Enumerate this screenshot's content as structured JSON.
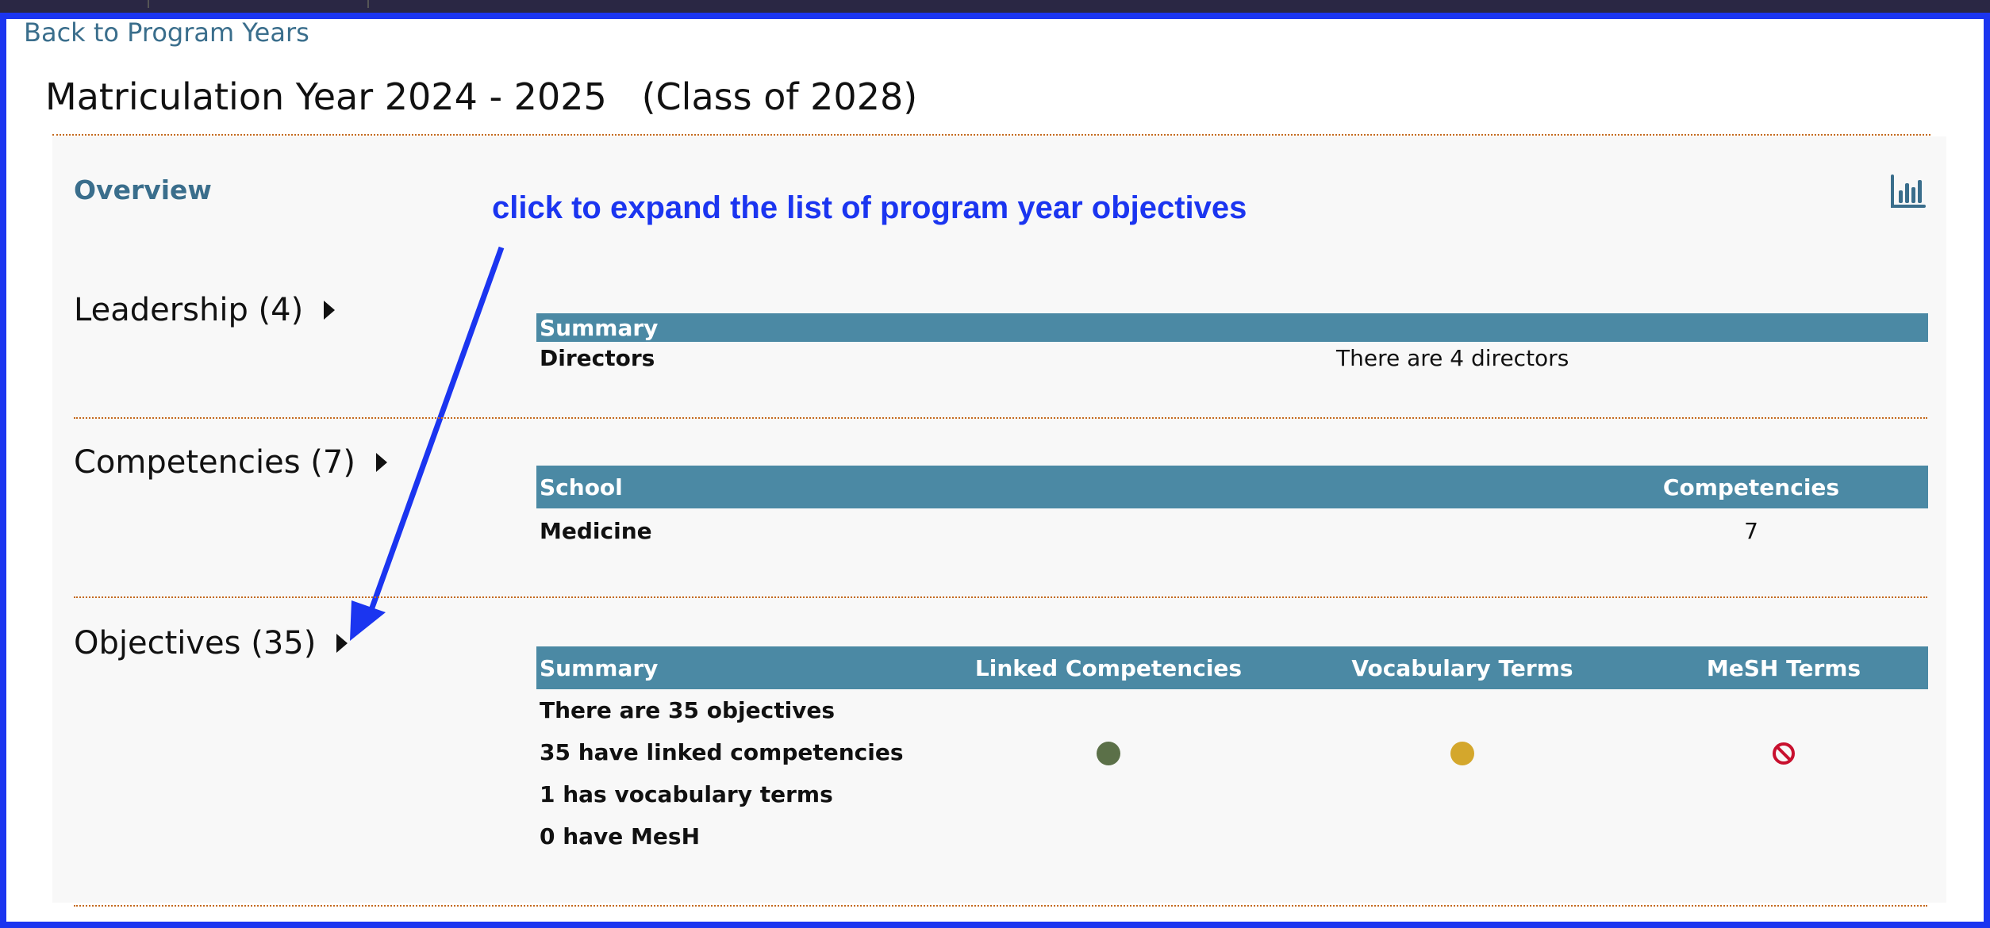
{
  "back_link": "Back to Program Years",
  "title": "Matriculation Year 2024 - 2025   (Class of 2028)",
  "overview_label": "Overview",
  "annotation": "click to expand the list of program year objectives",
  "leadership": {
    "title": "Leadership (4)",
    "header": "Summary",
    "row_label": "Directors",
    "row_value": "There are 4 directors"
  },
  "competencies": {
    "title": "Competencies (7)",
    "headers": [
      "School",
      "Competencies"
    ],
    "row_school": "Medicine",
    "row_count": "7"
  },
  "objectives": {
    "title": "Objectives (35)",
    "headers": [
      "Summary",
      "Linked Competencies",
      "Vocabulary Terms",
      "MeSH Terms"
    ],
    "rows": [
      "There are 35 objectives",
      "35 have linked competencies",
      "1 has vocabulary terms",
      "0 have MesH"
    ],
    "status": {
      "linked_competencies": {
        "icon": "status-dot-icon",
        "color": "#5b7048"
      },
      "vocabulary_terms": {
        "icon": "status-dot-icon",
        "color": "#d4a72c"
      },
      "mesh_terms": {
        "icon": "prohibited-icon",
        "color": "#c8102e"
      }
    }
  },
  "colors": {
    "frame_border": "#1b35f0",
    "link": "#3a6e8c",
    "table_header": "#4b89a4",
    "accent_orange": "#c46a1f"
  }
}
